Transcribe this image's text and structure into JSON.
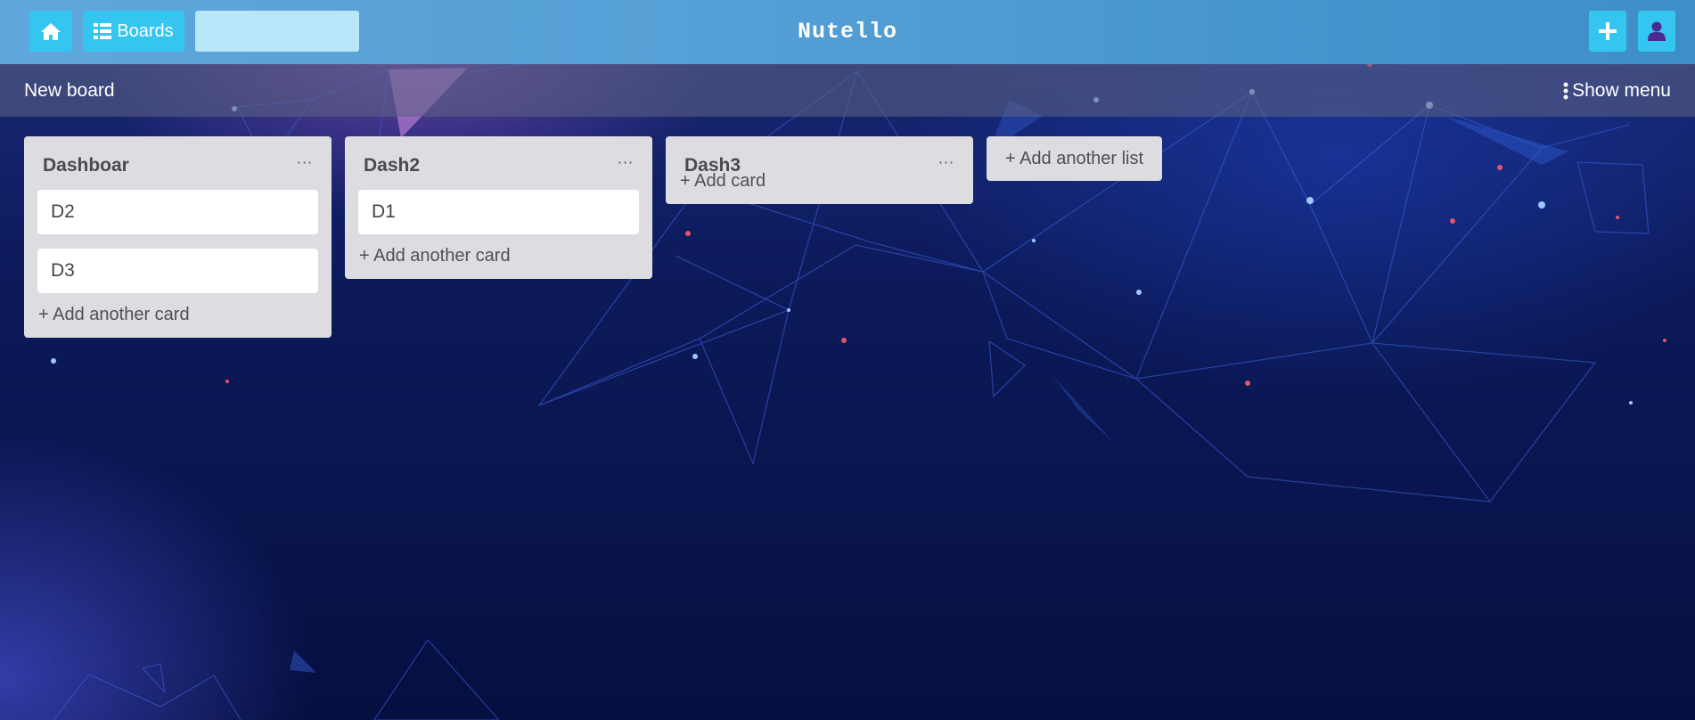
{
  "topbar": {
    "boards_label": "Boards",
    "search_value": "",
    "brand": "Nutello"
  },
  "board": {
    "title": "New board",
    "show_menu_label": "Show menu"
  },
  "lists": [
    {
      "title": "Dashboar",
      "menu": "···",
      "cards": [
        "D2",
        "D3"
      ],
      "add_label": "+ Add another card"
    },
    {
      "title": "Dash2",
      "menu": "···",
      "cards": [
        "D1"
      ],
      "add_label": "+ Add another card"
    },
    {
      "title": "Dash3",
      "menu": "···",
      "cards": [],
      "add_label": "+ Add card"
    }
  ],
  "add_list_label": "+ Add another list",
  "icons": {
    "home": "home-icon",
    "boards": "list-icon",
    "plus": "plus-icon",
    "user": "user-icon",
    "menu": "vertical-ellipsis-icon"
  },
  "colors": {
    "topbar_button": "#34c6f0",
    "search_box": "#b9e6f8",
    "list_bg": "#dddce0",
    "user_icon": "#4a2a8c"
  }
}
